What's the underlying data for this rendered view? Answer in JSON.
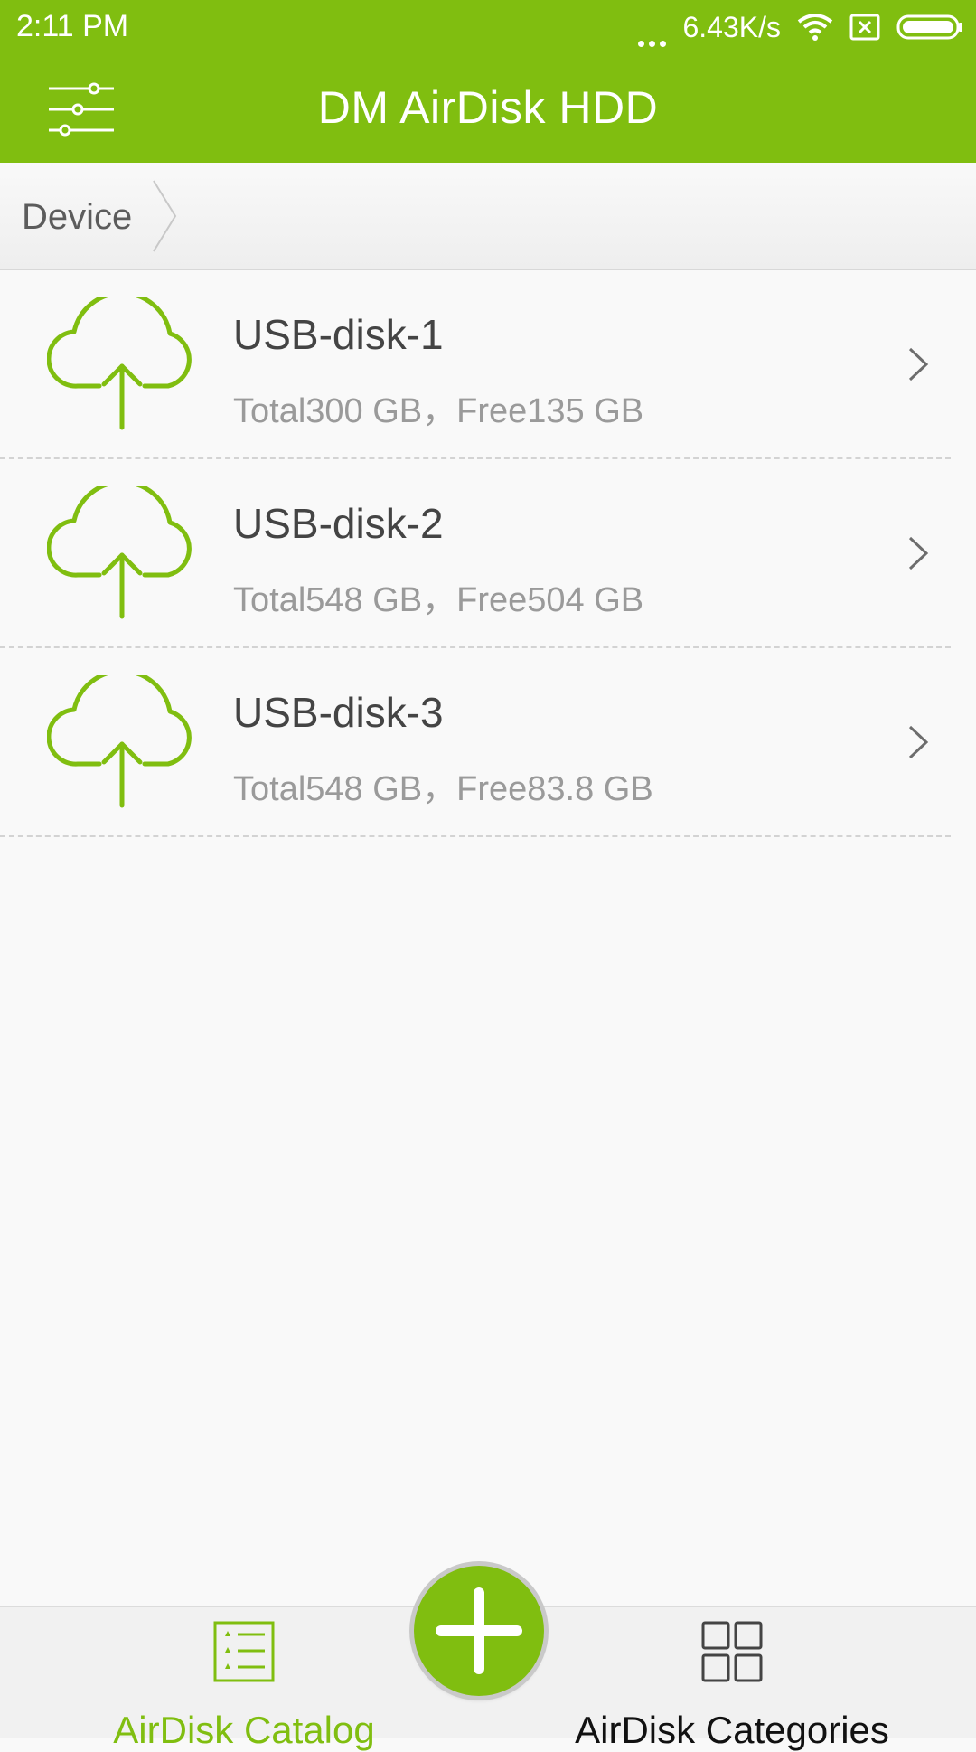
{
  "colors": {
    "brand": "#80be10",
    "background": "#f9f9f9",
    "text_primary": "#444444",
    "text_secondary": "#9a9a9a"
  },
  "status_bar": {
    "time": "2:11 PM",
    "network_speed": "6.43K/s",
    "icons": [
      "dots-icon",
      "wifi-icon",
      "sim-off-icon",
      "battery-icon"
    ]
  },
  "app_bar": {
    "title": "DM AirDisk HDD",
    "menu_icon": "sliders-icon"
  },
  "breadcrumb": {
    "items": [
      "Device"
    ]
  },
  "devices": [
    {
      "name": "USB-disk-1",
      "info": "Total300 GB，Free135 GB",
      "icon": "cloud-upload-icon"
    },
    {
      "name": "USB-disk-2",
      "info": "Total548 GB，Free504 GB",
      "icon": "cloud-upload-icon"
    },
    {
      "name": "USB-disk-3",
      "info": "Total548 GB，Free83.8 GB",
      "icon": "cloud-upload-icon"
    }
  ],
  "bottom_nav": {
    "catalog_label": "AirDisk Catalog",
    "categories_label": "AirDisk Categories",
    "fab_icon": "plus-icon"
  }
}
